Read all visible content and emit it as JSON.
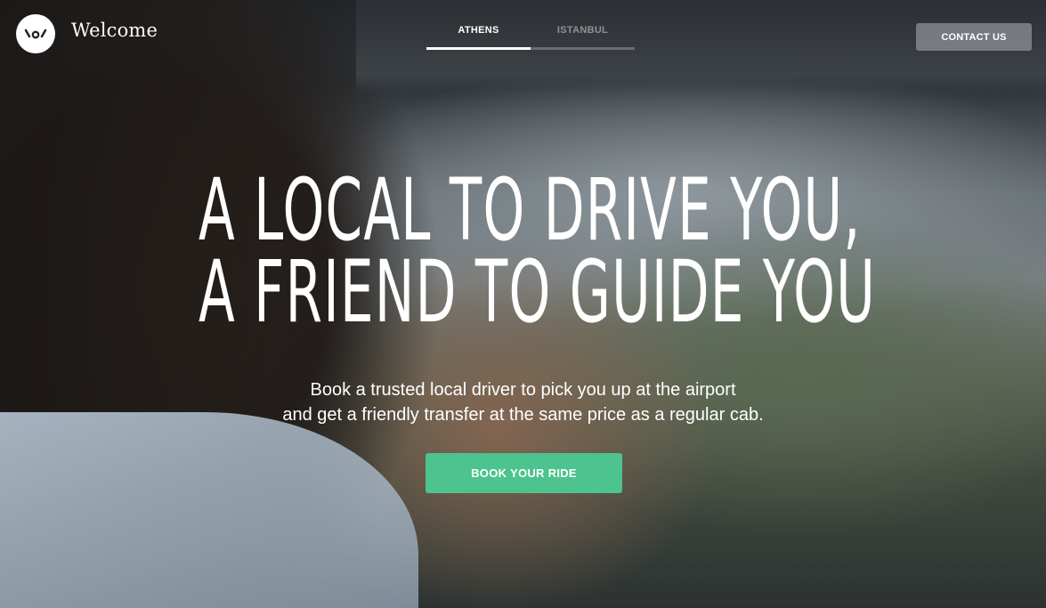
{
  "header": {
    "brand": "Welcome",
    "tabs": [
      {
        "label": "ATHENS",
        "active": true
      },
      {
        "label": "ISTANBUL",
        "active": false
      }
    ],
    "contact_label": "CONTACT US"
  },
  "hero": {
    "headline_line1": "A LOCAL TO DRIVE YOU,",
    "headline_line2": "A FRIEND TO GUIDE YOU",
    "subtitle_line1": "Book a trusted local driver to pick you up at the airport",
    "subtitle_line2": "and get a friendly transfer at the same price as a regular cab.",
    "cta_label": "BOOK YOUR RIDE"
  },
  "colors": {
    "accent": "#4dc38f",
    "text": "#ffffff"
  },
  "icons": {
    "logo": "welcome-logo-icon"
  }
}
